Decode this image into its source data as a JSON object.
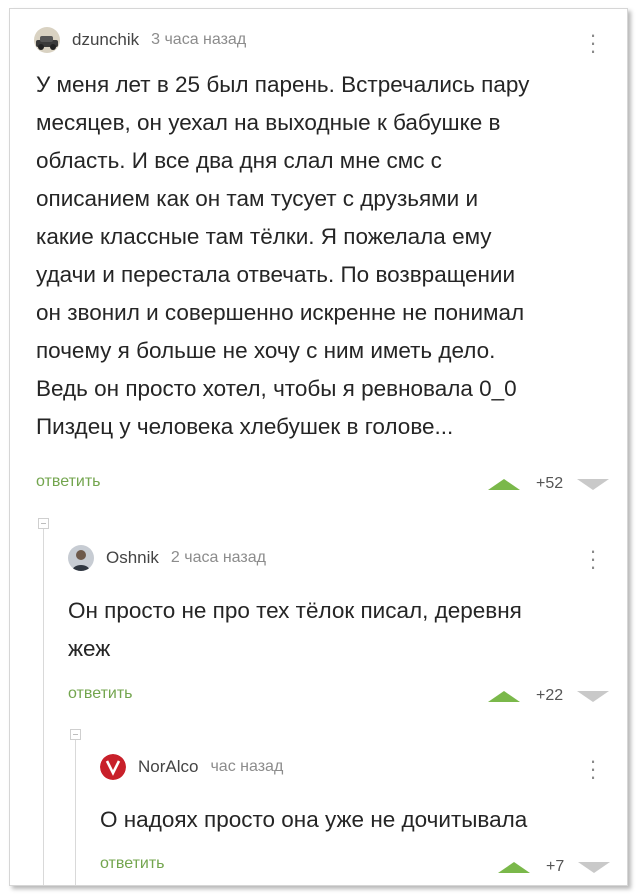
{
  "comments": [
    {
      "author": "dzunchik",
      "time": "3 часа назад",
      "text": "У меня лет в 25 был парень. Встречались пару\nмесяцев, он уехал на выходные к бабушке в\nобласть. И все два дня слал мне смс с\nописанием как он там тусует с друзьями и\nкакие классные там тёлки. Я пожелала ему\nудачи и перестала отвечать. По возвращении\nон звонил и совершенно искренне не понимал\nпочему я больше не хочу с ним иметь дело.\nВедь он просто хотел, чтобы я ревновала 0_0\nПиздец у человека хлебушек в голове...",
      "reply_label": "ответить",
      "score": "+52",
      "avatar_icon": "car-avatar-icon"
    },
    {
      "author": "Oshnik",
      "time": "2 часа назад",
      "text": "Он просто не про тех тёлок писал, деревня\nжеж",
      "reply_label": "ответить",
      "score": "+22",
      "avatar_icon": "person-avatar-icon"
    },
    {
      "author": "NorAlco",
      "time": "час назад",
      "text": "О надоях просто она уже не дочитывала",
      "reply_label": "ответить",
      "score": "+7",
      "avatar_icon": "logo-avatar-icon"
    }
  ],
  "colors": {
    "reply_green": "#73a54e",
    "upvote_green": "#7ab84a",
    "downvote_gray": "#c9c9c9"
  }
}
